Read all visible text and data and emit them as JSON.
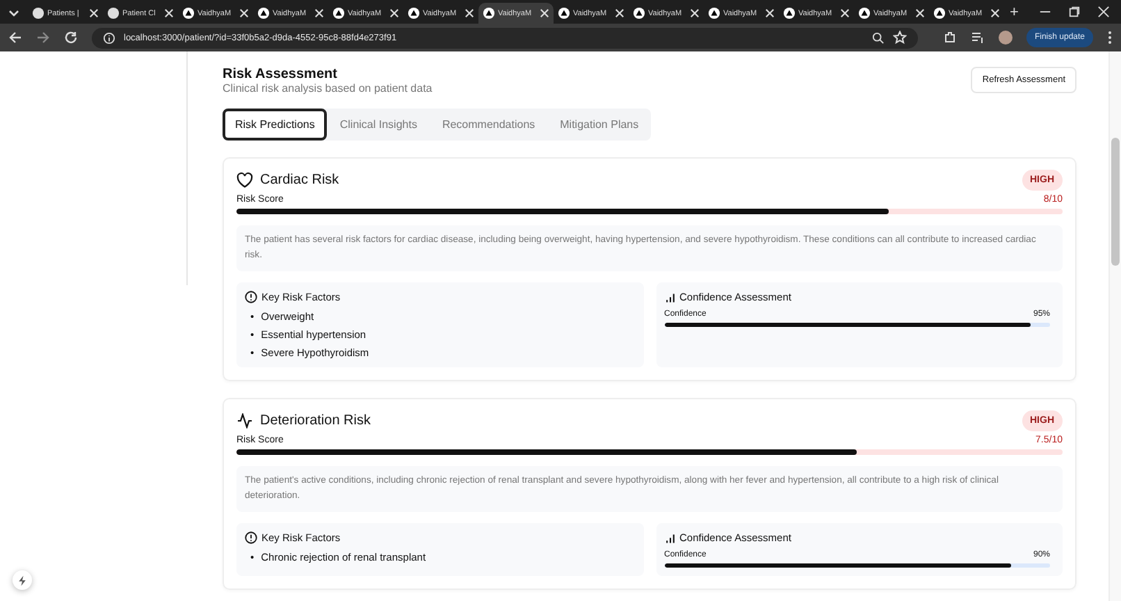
{
  "browser": {
    "tabs": [
      {
        "label": "Patients |",
        "selected": false,
        "kind": "app"
      },
      {
        "label": "Patient Cl",
        "selected": false,
        "kind": "app"
      },
      {
        "label": "VaidhyaM",
        "selected": false,
        "kind": "vaidhya"
      },
      {
        "label": "VaidhyaM",
        "selected": false,
        "kind": "vaidhya"
      },
      {
        "label": "VaidhyaM",
        "selected": false,
        "kind": "vaidhya"
      },
      {
        "label": "VaidhyaM",
        "selected": false,
        "kind": "vaidhya"
      },
      {
        "label": "VaidhyaM",
        "selected": true,
        "kind": "vaidhya"
      },
      {
        "label": "VaidhyaM",
        "selected": false,
        "kind": "vaidhya"
      },
      {
        "label": "VaidhyaM",
        "selected": false,
        "kind": "vaidhya"
      },
      {
        "label": "VaidhyaM",
        "selected": false,
        "kind": "vaidhya"
      },
      {
        "label": "VaidhyaM",
        "selected": false,
        "kind": "vaidhya"
      },
      {
        "label": "VaidhyaM",
        "selected": false,
        "kind": "vaidhya"
      },
      {
        "label": "VaidhyaM",
        "selected": false,
        "kind": "vaidhya"
      }
    ],
    "new_tab": "+",
    "url": "localhost:3000/patient/?id=33f0b5a2-d9da-4552-95c8-88fd4e273f91",
    "update_button": "Finish update"
  },
  "header": {
    "title": "Risk Assessment",
    "subtitle": "Clinical risk analysis based on patient data",
    "refresh_button": "Refresh Assessment"
  },
  "tabs": [
    {
      "label": "Risk Predictions",
      "selected": true
    },
    {
      "label": "Clinical Insights",
      "selected": false
    },
    {
      "label": "Recommendations",
      "selected": false
    },
    {
      "label": "Mitigation Plans",
      "selected": false
    }
  ],
  "risks": [
    {
      "kind": "heart",
      "title": "Cardiac Risk",
      "badge": "HIGH",
      "score_label": "Risk Score",
      "score": "8/10",
      "level": 0.79,
      "summary": "The patient has several risk factors for cardiac disease, including being overweight, having hypertension, and severe hypothyroidism. These conditions can all contribute to increased cardiac risk.",
      "factors_title": "Key Risk Factors",
      "bullet": "•",
      "factors": [
        "Overweight",
        "Essential hypertension",
        "Severe Hypothyroidism"
      ],
      "confidence": {
        "title": "Confidence Assessment",
        "label": "Confidence",
        "value": "95%",
        "level": 0.95
      }
    },
    {
      "kind": "activity",
      "title": "Deterioration Risk",
      "badge": "HIGH",
      "score_label": "Risk Score",
      "score": "7.5/10",
      "level": 0.75,
      "summary": "The patient's active conditions, including chronic rejection of renal transplant and severe hypothyroidism, along with her fever and hypertension, all contribute to a high risk of clinical deterioration.",
      "factors_title": "Key Risk Factors",
      "bullet": "•",
      "factors": [
        "Chronic rejection of renal transplant"
      ],
      "confidence": {
        "title": "Confidence Assessment",
        "label": "Confidence",
        "value": "90%",
        "level": 0.9
      }
    }
  ]
}
